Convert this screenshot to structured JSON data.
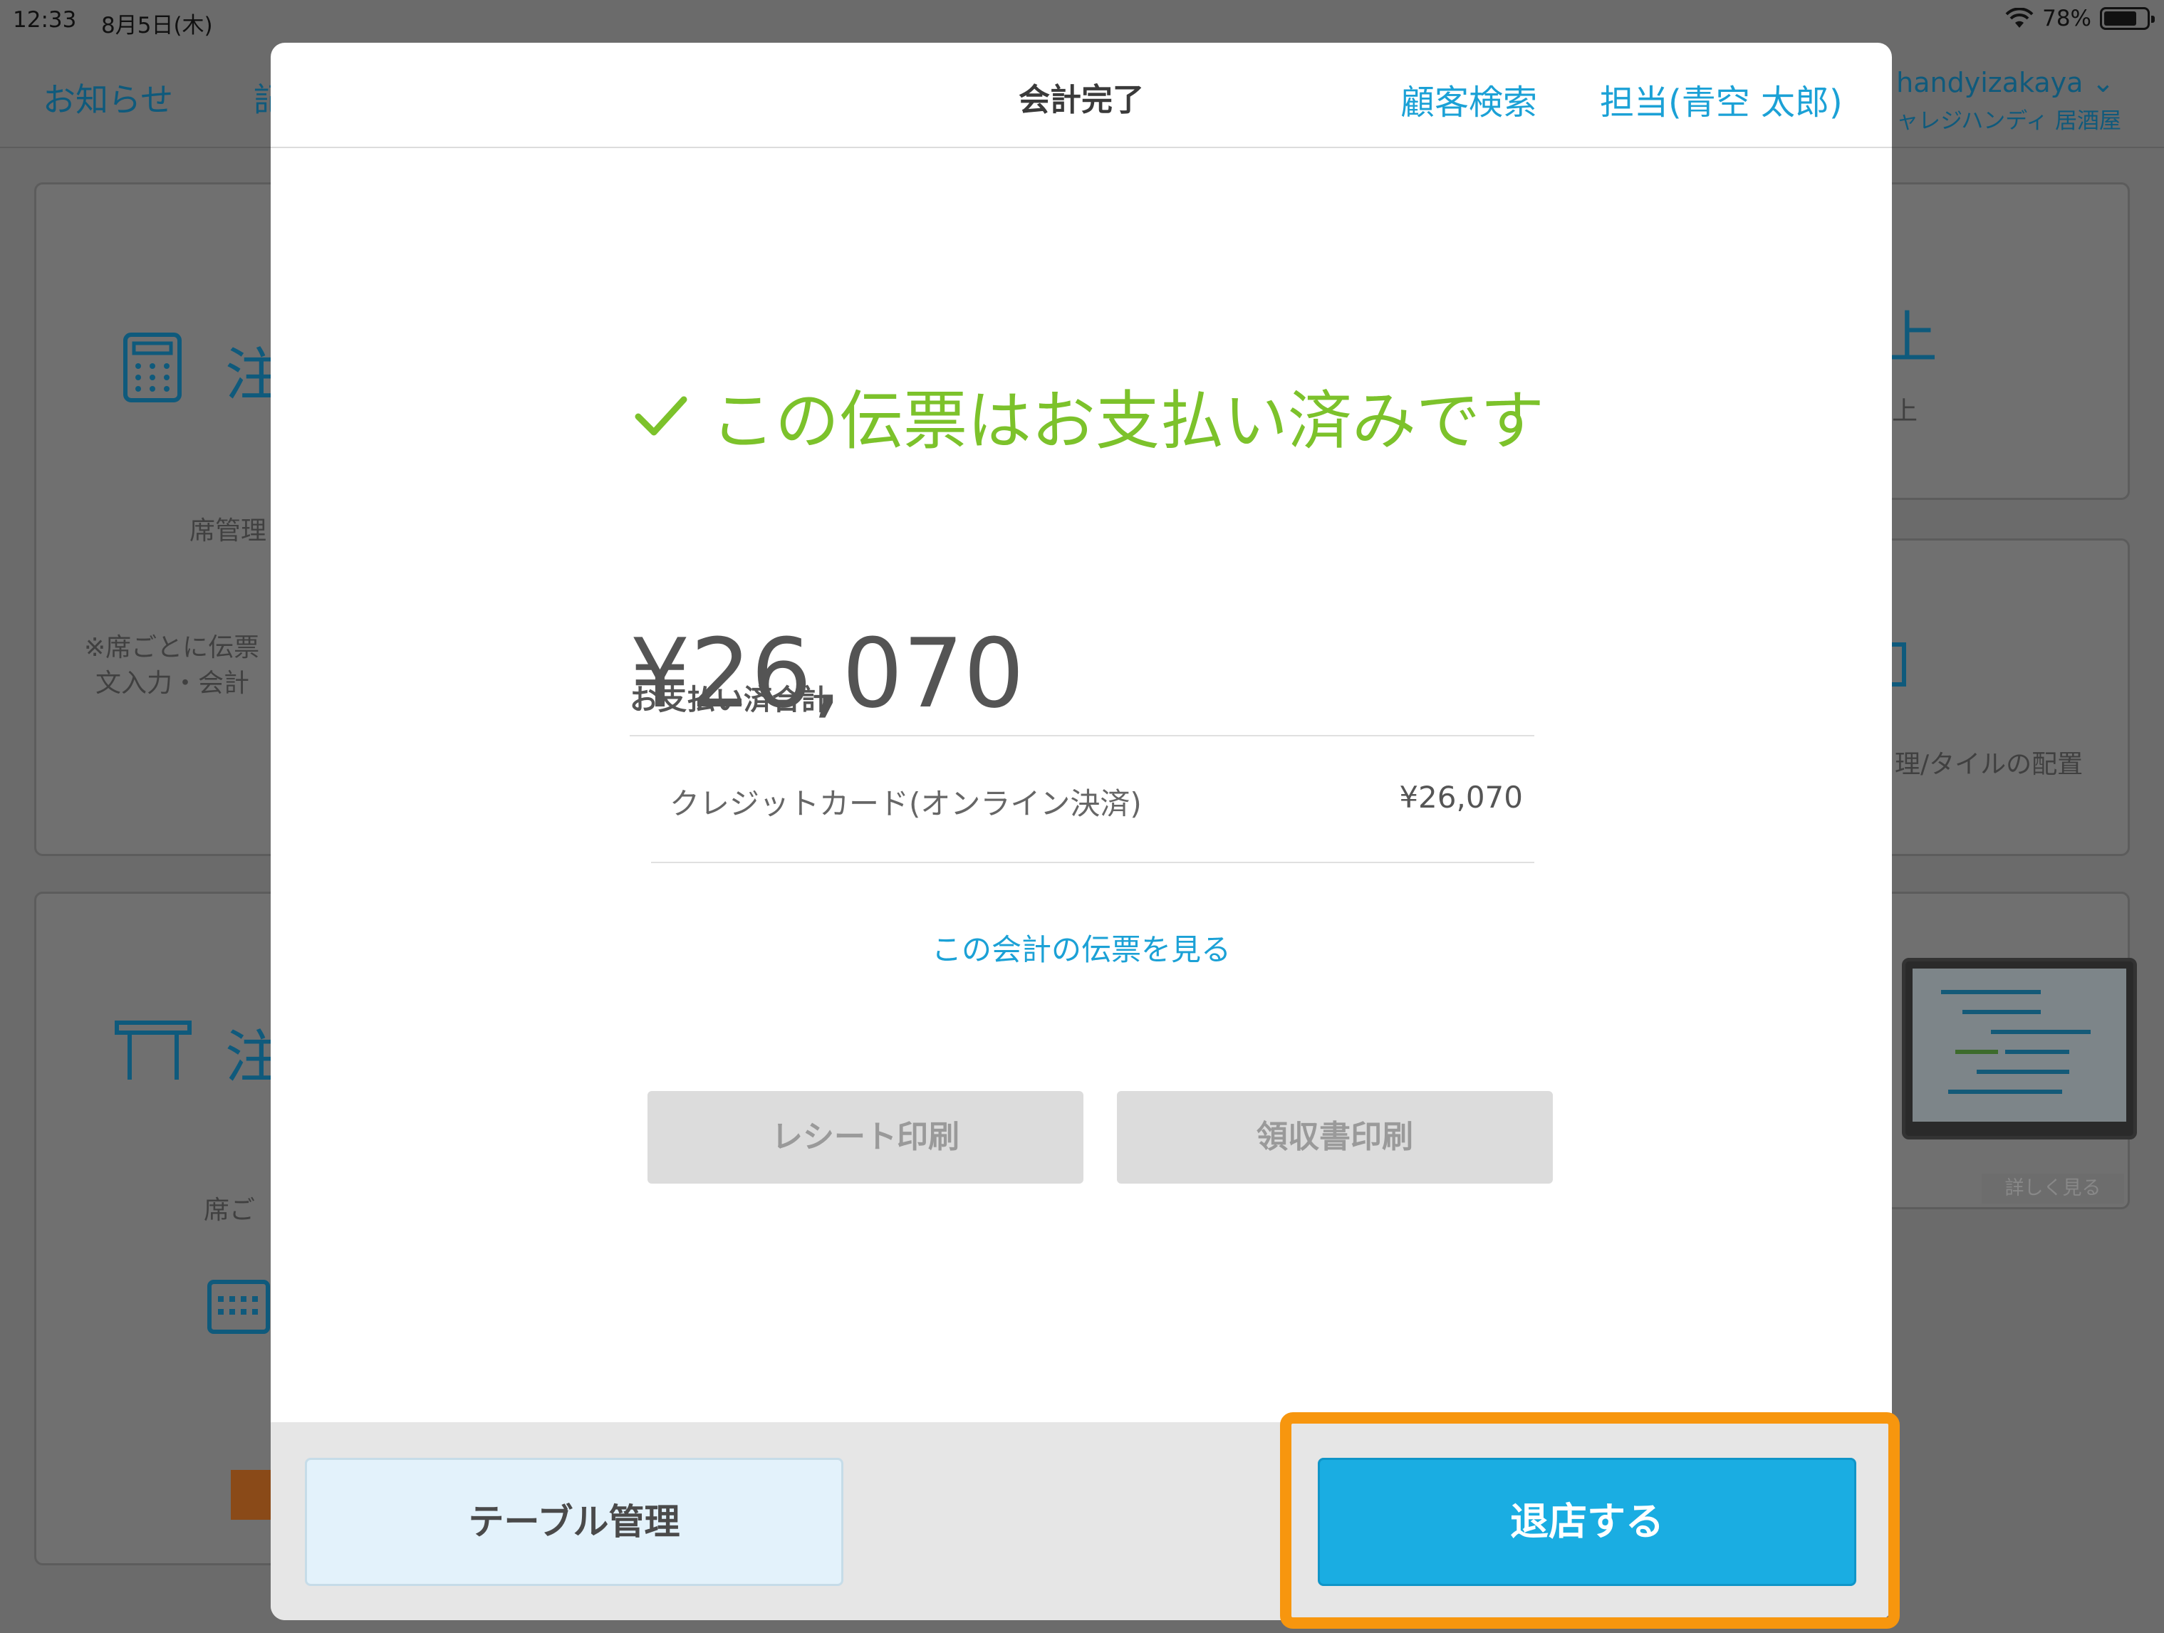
{
  "status_bar": {
    "time": "12:33",
    "date": "8月5日(木)",
    "battery": "78%",
    "battery_level": 0.78
  },
  "background": {
    "nav": {
      "news": "お知らせ",
      "second_tab": "記",
      "store_id": "handyizakaya",
      "store_name": "ャレジハンディ 居酒屋"
    },
    "left_card_1": {
      "title": "注",
      "caption": "席管理",
      "note_line1": "※席ごとに伝票",
      "note_line2": "文入力・会計"
    },
    "left_card_2": {
      "title": "注",
      "caption": "席ご"
    },
    "right_card_1": {
      "title": "上",
      "caption": "上"
    },
    "right_card_2": {
      "caption": "理/タイルの配置"
    },
    "right_card_3": {
      "more": "詳しく見る"
    }
  },
  "modal": {
    "title": "会計完了",
    "customer_search": "顧客検索",
    "staff": "担当(青空 太郎)",
    "paid_message": "この伝票はお支払い済みです",
    "total_label": "お支払い済合計",
    "total_amount": "¥26,070",
    "payment_method": "クレジットカード(オンライン決済)",
    "payment_amount": "¥26,070",
    "view_receipt_link": "この会計の伝票を見る",
    "receipt_print": "レシート印刷",
    "invoice_print": "領収書印刷",
    "table_manage": "テーブル管理",
    "leave": "退店する"
  },
  "colors": {
    "accent": "#1ba1d6",
    "success": "#7cc22b",
    "primary_button": "#1aade2",
    "highlight": "#f7960e"
  }
}
